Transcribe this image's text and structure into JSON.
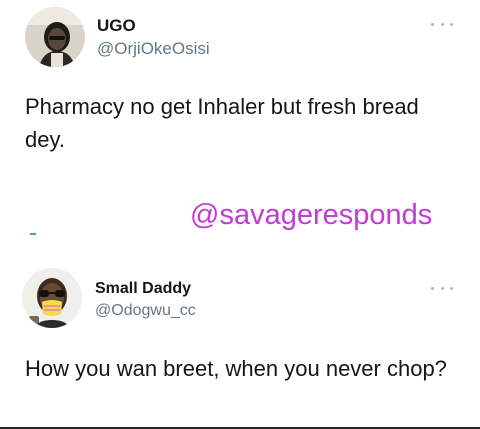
{
  "tweets": [
    {
      "name": "UGO",
      "handle": "@OrjiOkeOsisi",
      "text": "Pharmacy no get Inhaler but fresh bread dey.",
      "avatar_icon": "profile-photo-icon"
    },
    {
      "name": "Small Daddy",
      "handle": "@Odogwu_cc",
      "text": "How you wan breet, when you never chop?",
      "avatar_icon": "profile-photo-icon"
    }
  ],
  "watermark": "@savageresponds",
  "colors": {
    "watermark": "#c13bd4",
    "handle": "#657786",
    "text": "#14171a",
    "more_dots": "#aab8c2"
  }
}
